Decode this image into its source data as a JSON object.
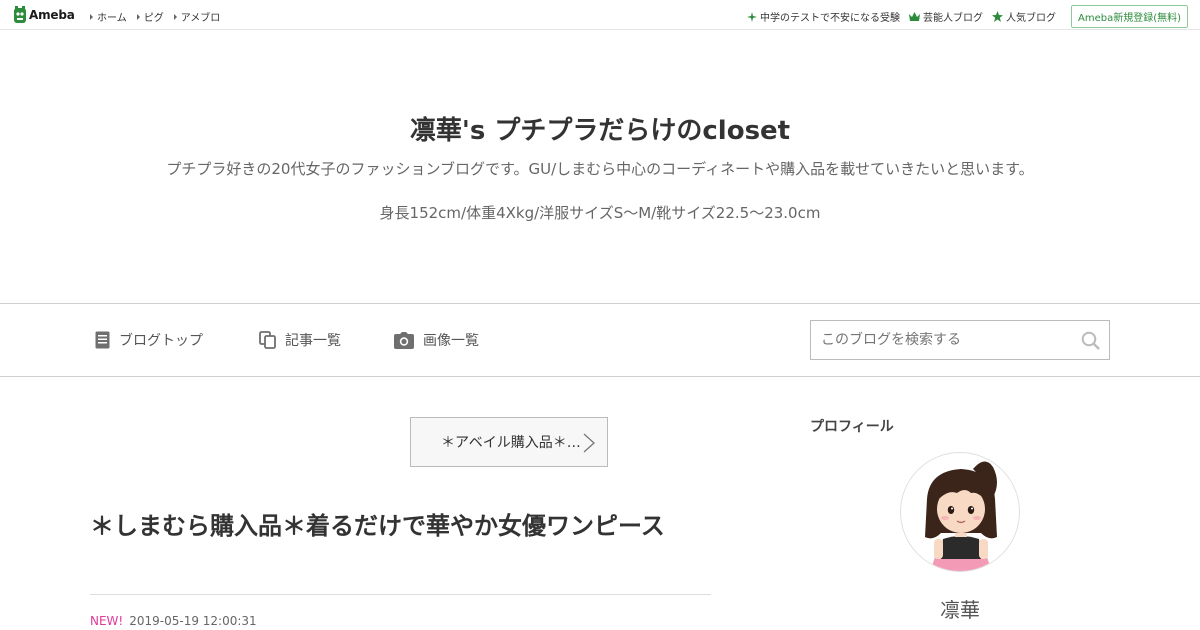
{
  "topbar": {
    "logo_text": "Ameba",
    "nav": [
      "ホーム",
      "ピグ",
      "アメブロ"
    ],
    "links": [
      {
        "label": "中学のテストで不安になる受験",
        "icon": "sparkle-icon"
      },
      {
        "label": "芸能人ブログ",
        "icon": "crown-icon"
      },
      {
        "label": "人気ブログ",
        "icon": "star-icon"
      }
    ],
    "register_label": "Ameba新規登録(無料)"
  },
  "header": {
    "title": "凛華's プチプラだらけのcloset",
    "description": "プチプラ好きの20代女子のファッションブログです。GU/しまむら中心のコーディネートや購入品を載せていきたいと思います。",
    "description2": "身長152cm/体重4Xkg/洋服サイズS〜M/靴サイズ22.5〜23.0cm"
  },
  "navbar": {
    "items": [
      {
        "label": "ブログトップ",
        "icon": "document-icon"
      },
      {
        "label": "記事一覧",
        "icon": "copy-icon"
      },
      {
        "label": "画像一覧",
        "icon": "camera-icon"
      }
    ],
    "search_placeholder": "このブログを検索する"
  },
  "post": {
    "theme_label": "＊アベイル購入品＊…",
    "title": "＊しまむら購入品＊着るだけで華やか女優ワンピース",
    "new_label": "NEW!",
    "date": "2019-05-19 12:00:31"
  },
  "sidebar": {
    "profile_heading": "プロフィール",
    "name": "凛華"
  },
  "colors": {
    "brand_green": "#2d8c3c",
    "new_pink": "#e2389b"
  }
}
